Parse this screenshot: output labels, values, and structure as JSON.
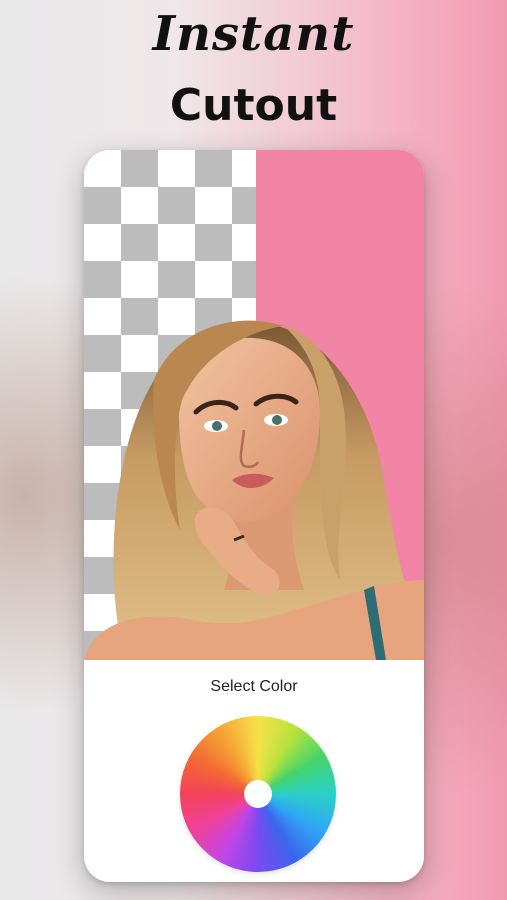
{
  "headline": {
    "script_word": "Instant",
    "bold_word": "Cutout"
  },
  "editor": {
    "select_color_label": "Select Color",
    "transparent_pattern": "checkerboard",
    "background_color": "#f285a5"
  },
  "colors": {
    "page_gradient_end": "#f29ab3",
    "checker_gray": "#bcbcbc",
    "wheel_center": "#ffffff"
  },
  "icons": {
    "color_wheel": "color-wheel-icon"
  }
}
